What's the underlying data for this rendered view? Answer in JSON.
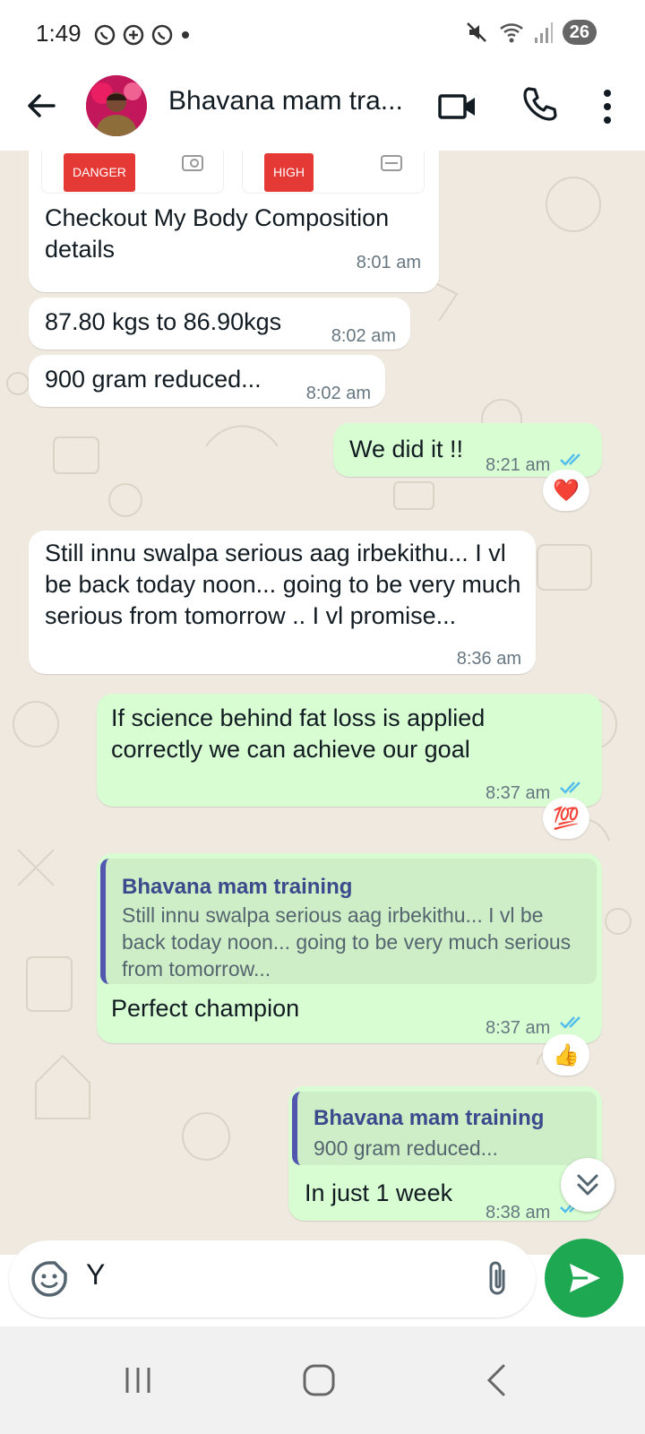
{
  "status_bar": {
    "time": "1:49",
    "battery": "26"
  },
  "header": {
    "title": "Bhavana mam tra...",
    "back_icon": "arrow-left-icon",
    "video_icon": "video-call-icon",
    "call_icon": "phone-icon",
    "more_icon": "more-vertical-icon"
  },
  "card_tags": {
    "left": "DANGER",
    "right": "HIGH"
  },
  "messages": [
    {
      "dir": "in",
      "text": "Checkout My Body Composition details",
      "time": "8:01 am"
    },
    {
      "dir": "in",
      "text": "87.80 kgs to 86.90kgs",
      "time": "8:02 am"
    },
    {
      "dir": "in",
      "text": "900 gram reduced...",
      "time": "8:02 am"
    },
    {
      "dir": "out",
      "text": "We did it !!",
      "time": "8:21 am",
      "reaction": "❤️"
    },
    {
      "dir": "in",
      "text": "Still innu swalpa serious aag irbekithu... I vl be back today noon... going to be very much serious from tomorrow .. I vl promise...",
      "time": "8:36 am"
    },
    {
      "dir": "out",
      "text": "If science behind  fat loss is applied correctly we can achieve our goal",
      "time": "8:37 am",
      "reaction": "💯"
    },
    {
      "dir": "out",
      "quote_author": "Bhavana mam training",
      "quote_text": "Still innu swalpa serious aag irbekithu... I vl be back today noon... going to be very much serious from tomorrow...",
      "text": "Perfect champion",
      "time": "8:37 am",
      "reaction": "👍"
    },
    {
      "dir": "out",
      "quote_author": "Bhavana mam training",
      "quote_text": "900 gram reduced...",
      "text": "In  just 1 week",
      "time": "8:38 am"
    }
  ],
  "composer": {
    "value": "Y",
    "emoji_icon": "sticker-icon",
    "attach_icon": "paperclip-icon",
    "send_icon": "send-icon"
  },
  "colors": {
    "outgoing": "#d8fdd2",
    "incoming": "#ffffff",
    "send": "#1da851",
    "ticks": "#53bdeb",
    "quote_bar": "#5157ae"
  }
}
